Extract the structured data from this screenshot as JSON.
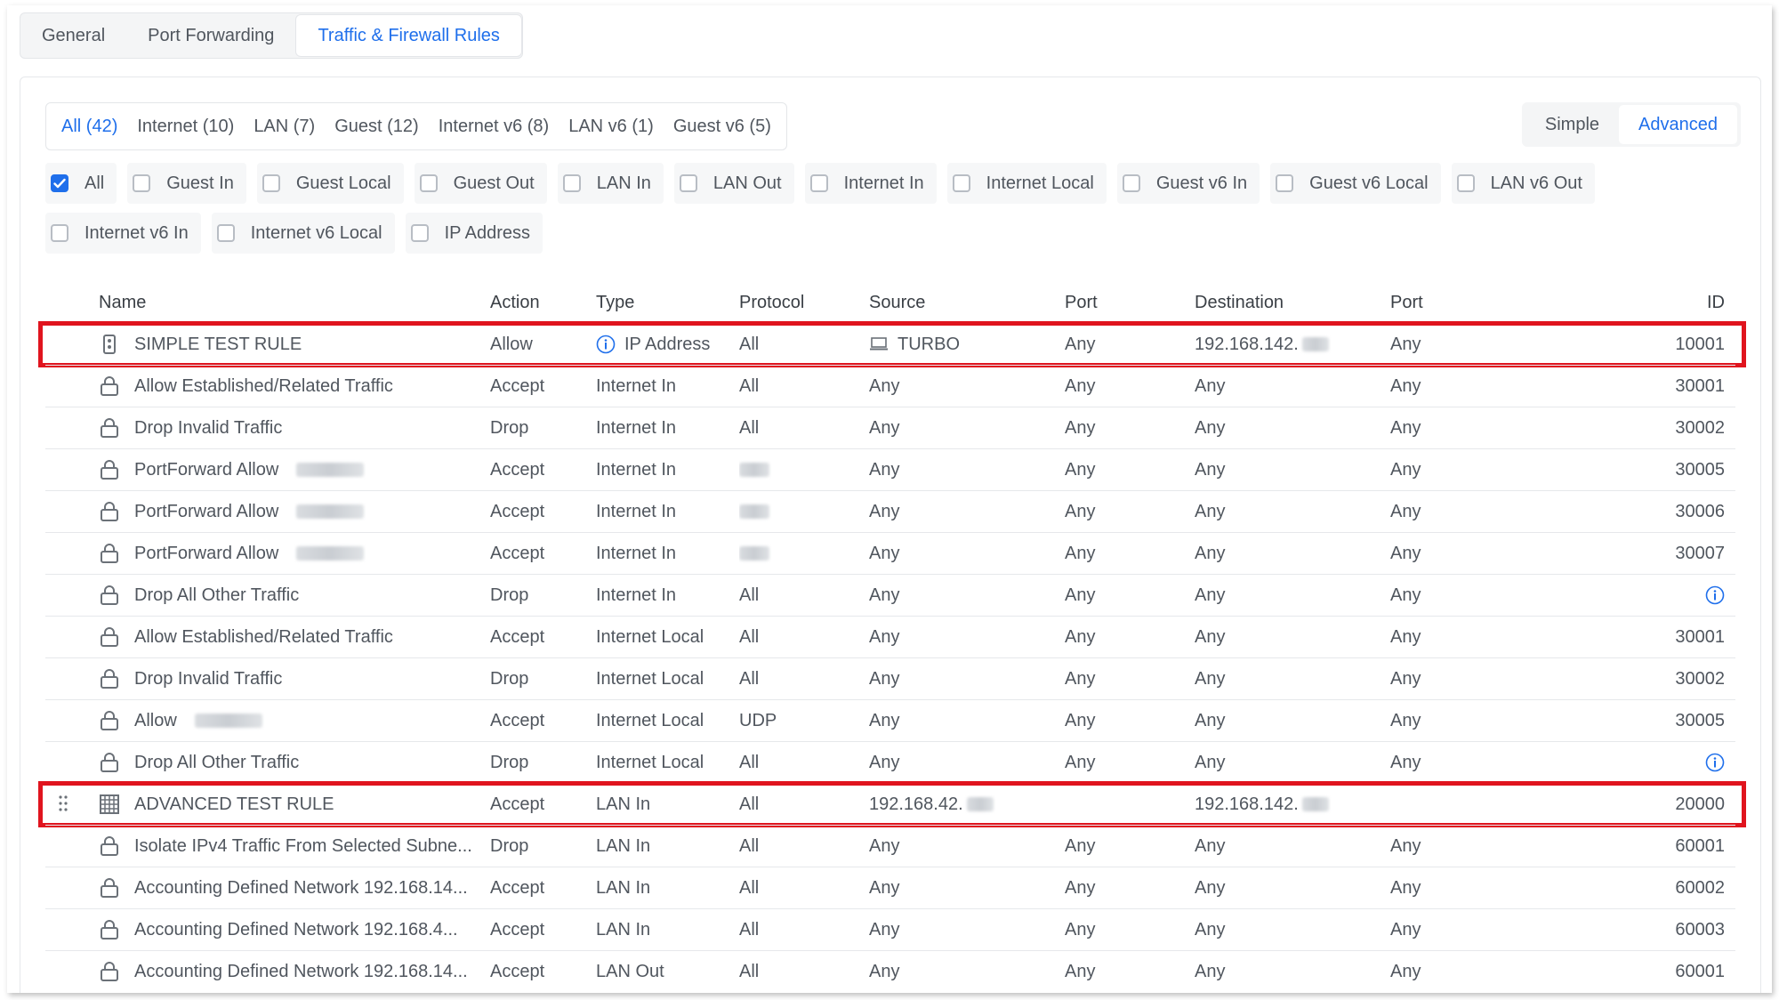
{
  "top_tabs": [
    {
      "label": "General",
      "active": false
    },
    {
      "label": "Port Forwarding",
      "active": false
    },
    {
      "label": "Traffic & Firewall Rules",
      "active": true
    }
  ],
  "filter_tabs": [
    {
      "label": "All (42)",
      "active": true
    },
    {
      "label": "Internet (10)",
      "active": false
    },
    {
      "label": "LAN (7)",
      "active": false
    },
    {
      "label": "Guest (12)",
      "active": false
    },
    {
      "label": "Internet v6 (8)",
      "active": false
    },
    {
      "label": "LAN v6 (1)",
      "active": false
    },
    {
      "label": "Guest v6 (5)",
      "active": false
    }
  ],
  "view_toggle": {
    "simple": "Simple",
    "advanced": "Advanced",
    "selected": "Advanced"
  },
  "checkboxes": [
    {
      "label": "All",
      "checked": true
    },
    {
      "label": "Guest In",
      "checked": false
    },
    {
      "label": "Guest Local",
      "checked": false
    },
    {
      "label": "Guest Out",
      "checked": false
    },
    {
      "label": "LAN In",
      "checked": false
    },
    {
      "label": "LAN Out",
      "checked": false
    },
    {
      "label": "Internet In",
      "checked": false
    },
    {
      "label": "Internet Local",
      "checked": false
    },
    {
      "label": "Guest v6 In",
      "checked": false
    },
    {
      "label": "Guest v6 Local",
      "checked": false
    },
    {
      "label": "LAN v6 Out",
      "checked": false
    },
    {
      "label": "Internet v6 In",
      "checked": false
    },
    {
      "label": "Internet v6 Local",
      "checked": false
    },
    {
      "label": "IP Address",
      "checked": false
    }
  ],
  "table": {
    "headers": {
      "name": "Name",
      "action": "Action",
      "type": "Type",
      "protocol": "Protocol",
      "source": "Source",
      "port1": "Port",
      "destination": "Destination",
      "port2": "Port",
      "id": "ID"
    },
    "rows": [
      {
        "icon": "device-icon",
        "name": "SIMPLE TEST RULE",
        "name_redacted": false,
        "action": "Allow",
        "type": "IP Address",
        "type_info": true,
        "protocol": "All",
        "protocol_redacted": false,
        "source": "TURBO",
        "source_icon": "laptop-icon",
        "source_redacted": false,
        "port1": "Any",
        "destination": "192.168.142.",
        "destination_redacted": true,
        "port2": "Any",
        "id": "10001",
        "id_info": false,
        "highlight": true,
        "drag": false
      },
      {
        "icon": "lock-icon",
        "name": "Allow Established/Related Traffic",
        "name_redacted": false,
        "action": "Accept",
        "type": "Internet In",
        "type_info": false,
        "protocol": "All",
        "protocol_redacted": false,
        "source": "Any",
        "source_icon": "",
        "source_redacted": false,
        "port1": "Any",
        "destination": "Any",
        "destination_redacted": false,
        "port2": "Any",
        "id": "30001",
        "id_info": false,
        "highlight": false,
        "drag": false
      },
      {
        "icon": "lock-icon",
        "name": "Drop Invalid Traffic",
        "name_redacted": false,
        "action": "Drop",
        "type": "Internet In",
        "type_info": false,
        "protocol": "All",
        "protocol_redacted": false,
        "source": "Any",
        "source_icon": "",
        "source_redacted": false,
        "port1": "Any",
        "destination": "Any",
        "destination_redacted": false,
        "port2": "Any",
        "id": "30002",
        "id_info": false,
        "highlight": false,
        "drag": false
      },
      {
        "icon": "lock-icon",
        "name": "PortForward Allow",
        "name_redacted": true,
        "action": "Accept",
        "type": "Internet In",
        "type_info": false,
        "protocol": "",
        "protocol_redacted": true,
        "source": "Any",
        "source_icon": "",
        "source_redacted": false,
        "port1": "Any",
        "destination": "Any",
        "destination_redacted": false,
        "port2": "Any",
        "id": "30005",
        "id_info": false,
        "highlight": false,
        "drag": false
      },
      {
        "icon": "lock-icon",
        "name": "PortForward Allow",
        "name_redacted": true,
        "action": "Accept",
        "type": "Internet In",
        "type_info": false,
        "protocol": "",
        "protocol_redacted": true,
        "source": "Any",
        "source_icon": "",
        "source_redacted": false,
        "port1": "Any",
        "destination": "Any",
        "destination_redacted": false,
        "port2": "Any",
        "id": "30006",
        "id_info": false,
        "highlight": false,
        "drag": false
      },
      {
        "icon": "lock-icon",
        "name": "PortForward Allow",
        "name_redacted": true,
        "action": "Accept",
        "type": "Internet In",
        "type_info": false,
        "protocol": "",
        "protocol_redacted": true,
        "source": "Any",
        "source_icon": "",
        "source_redacted": false,
        "port1": "Any",
        "destination": "Any",
        "destination_redacted": false,
        "port2": "Any",
        "id": "30007",
        "id_info": false,
        "highlight": false,
        "drag": false
      },
      {
        "icon": "lock-icon",
        "name": "Drop All Other Traffic",
        "name_redacted": false,
        "action": "Drop",
        "type": "Internet In",
        "type_info": false,
        "protocol": "All",
        "protocol_redacted": false,
        "source": "Any",
        "source_icon": "",
        "source_redacted": false,
        "port1": "Any",
        "destination": "Any",
        "destination_redacted": false,
        "port2": "Any",
        "id": "",
        "id_info": true,
        "highlight": false,
        "drag": false
      },
      {
        "icon": "lock-icon",
        "name": "Allow Established/Related Traffic",
        "name_redacted": false,
        "action": "Accept",
        "type": "Internet Local",
        "type_info": false,
        "protocol": "All",
        "protocol_redacted": false,
        "source": "Any",
        "source_icon": "",
        "source_redacted": false,
        "port1": "Any",
        "destination": "Any",
        "destination_redacted": false,
        "port2": "Any",
        "id": "30001",
        "id_info": false,
        "highlight": false,
        "drag": false
      },
      {
        "icon": "lock-icon",
        "name": "Drop Invalid Traffic",
        "name_redacted": false,
        "action": "Drop",
        "type": "Internet Local",
        "type_info": false,
        "protocol": "All",
        "protocol_redacted": false,
        "source": "Any",
        "source_icon": "",
        "source_redacted": false,
        "port1": "Any",
        "destination": "Any",
        "destination_redacted": false,
        "port2": "Any",
        "id": "30002",
        "id_info": false,
        "highlight": false,
        "drag": false
      },
      {
        "icon": "lock-icon",
        "name": "Allow",
        "name_redacted": true,
        "action": "Accept",
        "type": "Internet Local",
        "type_info": false,
        "protocol": "UDP",
        "protocol_redacted": false,
        "source": "Any",
        "source_icon": "",
        "source_redacted": false,
        "port1": "Any",
        "destination": "Any",
        "destination_redacted": false,
        "port2": "Any",
        "id": "30005",
        "id_info": false,
        "highlight": false,
        "drag": false
      },
      {
        "icon": "lock-icon",
        "name": "Drop All Other Traffic",
        "name_redacted": false,
        "action": "Drop",
        "type": "Internet Local",
        "type_info": false,
        "protocol": "All",
        "protocol_redacted": false,
        "source": "Any",
        "source_icon": "",
        "source_redacted": false,
        "port1": "Any",
        "destination": "Any",
        "destination_redacted": false,
        "port2": "Any",
        "id": "",
        "id_info": true,
        "highlight": false,
        "drag": false
      },
      {
        "icon": "grid-icon",
        "name": "ADVANCED TEST RULE",
        "name_redacted": false,
        "action": "Accept",
        "type": "LAN In",
        "type_info": false,
        "protocol": "All",
        "protocol_redacted": false,
        "source": "192.168.42.",
        "source_icon": "",
        "source_redacted": true,
        "port1": "",
        "destination": "192.168.142.",
        "destination_redacted": true,
        "port2": "",
        "id": "20000",
        "id_info": false,
        "highlight": true,
        "drag": true
      },
      {
        "icon": "lock-icon",
        "name": "Isolate IPv4 Traffic From Selected Subne...",
        "name_redacted": false,
        "action": "Drop",
        "type": "LAN In",
        "type_info": false,
        "protocol": "All",
        "protocol_redacted": false,
        "source": "Any",
        "source_icon": "",
        "source_redacted": false,
        "port1": "Any",
        "destination": "Any",
        "destination_redacted": false,
        "port2": "Any",
        "id": "60001",
        "id_info": false,
        "highlight": false,
        "drag": false
      },
      {
        "icon": "lock-icon",
        "name": "Accounting Defined Network 192.168.14...",
        "name_redacted": false,
        "action": "Accept",
        "type": "LAN In",
        "type_info": false,
        "protocol": "All",
        "protocol_redacted": false,
        "source": "Any",
        "source_icon": "",
        "source_redacted": false,
        "port1": "Any",
        "destination": "Any",
        "destination_redacted": false,
        "port2": "Any",
        "id": "60002",
        "id_info": false,
        "highlight": false,
        "drag": false
      },
      {
        "icon": "lock-icon",
        "name": "Accounting Defined Network 192.168.4...",
        "name_redacted": false,
        "action": "Accept",
        "type": "LAN In",
        "type_info": false,
        "protocol": "All",
        "protocol_redacted": false,
        "source": "Any",
        "source_icon": "",
        "source_redacted": false,
        "port1": "Any",
        "destination": "Any",
        "destination_redacted": false,
        "port2": "Any",
        "id": "60003",
        "id_info": false,
        "highlight": false,
        "drag": false
      },
      {
        "icon": "lock-icon",
        "name": "Accounting Defined Network 192.168.14...",
        "name_redacted": false,
        "action": "Accept",
        "type": "LAN Out",
        "type_info": false,
        "protocol": "All",
        "protocol_redacted": false,
        "source": "Any",
        "source_icon": "",
        "source_redacted": false,
        "port1": "Any",
        "destination": "Any",
        "destination_redacted": false,
        "port2": "Any",
        "id": "60001",
        "id_info": false,
        "highlight": false,
        "drag": false
      }
    ]
  },
  "colors": {
    "accent": "#1f6feb",
    "highlight": "#e0141e",
    "text": "#50565e"
  }
}
